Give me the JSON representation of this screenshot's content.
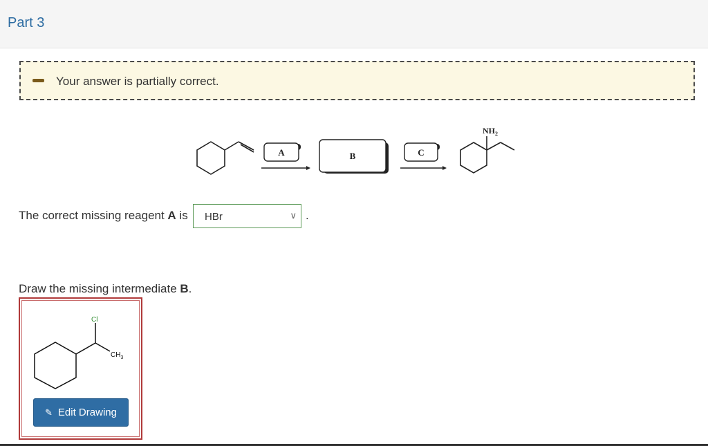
{
  "part": {
    "title": "Part 3"
  },
  "feedback": {
    "message": "Your answer is partially correct."
  },
  "scheme": {
    "reagent_a": "A",
    "intermediate_b": "B",
    "reagent_c": "C",
    "product_label": "NH",
    "product_label_sub": "2"
  },
  "question_a": {
    "prefix": "The correct missing reagent ",
    "bold": "A",
    "suffix": " is",
    "selected": "HBr",
    "period": "."
  },
  "question_b": {
    "prefix": "Draw the missing intermediate ",
    "bold": "B",
    "period": ".",
    "cl_label": "Cl",
    "ch3_label": "CH",
    "ch3_sub": "3",
    "edit_label": "Edit Drawing"
  },
  "colors": {
    "accent": "#2d6ca2",
    "feedback_bg": "#fcf8e3",
    "incorrect_border": "#b03a3a",
    "select_border": "#5b9a57",
    "chlorine": "#2e8b2e"
  },
  "icons": {
    "feedback": "dash-icon",
    "edit": "pencil-icon",
    "select": "chevron-down-icon"
  }
}
